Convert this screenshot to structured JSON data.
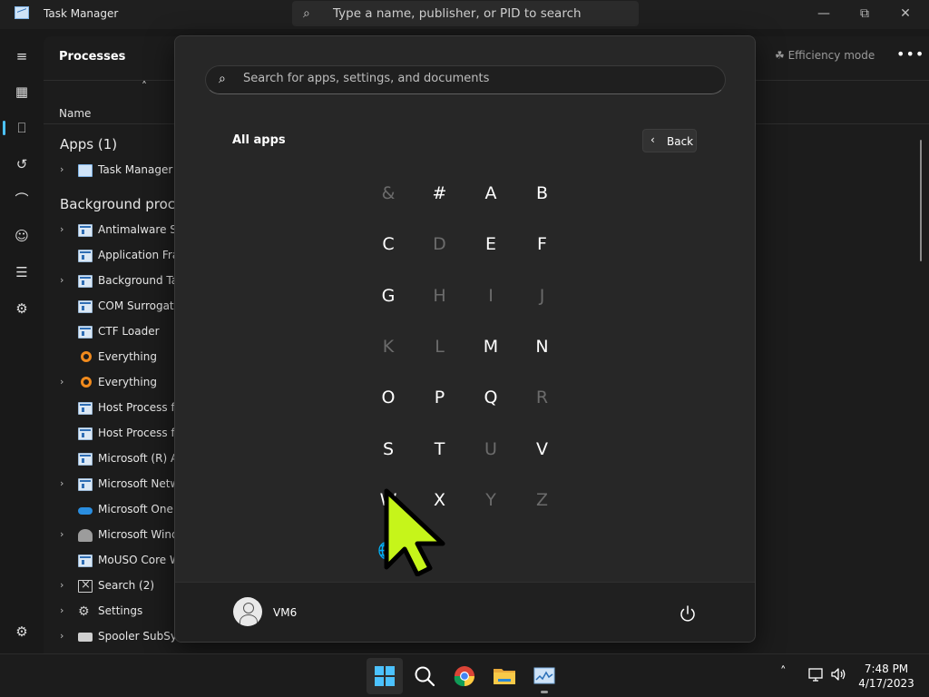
{
  "task_manager": {
    "title": "Task Manager",
    "search_placeholder": "Type a name, publisher, or PID to search",
    "page_heading": "Processes",
    "efficiency_mode_label": "Efficiency mode",
    "more_label": "•••",
    "column_name": "Name",
    "groups": {
      "apps": "Apps (1)",
      "background": "Background proce"
    },
    "processes": [
      {
        "label": "Task Manager",
        "icon": "task-manager-icon",
        "expandable": true
      },
      {
        "label": "Antimalware Ser",
        "icon": "window-icon",
        "expandable": true
      },
      {
        "label": "Application Fran",
        "icon": "window-icon",
        "expandable": false
      },
      {
        "label": "Background Tas",
        "icon": "window-icon",
        "expandable": true
      },
      {
        "label": "COM Surrogate",
        "icon": "window-icon",
        "expandable": false
      },
      {
        "label": "CTF Loader",
        "icon": "window-icon",
        "expandable": false
      },
      {
        "label": "Everything",
        "icon": "everything-icon",
        "expandable": false
      },
      {
        "label": "Everything",
        "icon": "everything-icon",
        "expandable": true
      },
      {
        "label": "Host Process for",
        "icon": "window-icon",
        "expandable": false
      },
      {
        "label": "Host Process for",
        "icon": "window-icon",
        "expandable": false
      },
      {
        "label": "Microsoft (R) Ag",
        "icon": "window-icon",
        "expandable": false
      },
      {
        "label": "Microsoft Netwo",
        "icon": "window-icon",
        "expandable": true
      },
      {
        "label": "Microsoft OneD",
        "icon": "onedrive-icon",
        "expandable": false
      },
      {
        "label": "Microsoft Windo",
        "icon": "user-icon",
        "expandable": true
      },
      {
        "label": "MoUSO Core W",
        "icon": "window-icon",
        "expandable": false
      },
      {
        "label": "Search (2)",
        "icon": "search-app-icon",
        "expandable": true
      },
      {
        "label": "Settings",
        "icon": "gear-icon",
        "expandable": true
      },
      {
        "label": "Spooler SubSyst",
        "icon": "printer-icon",
        "expandable": true
      }
    ],
    "nav_icons": [
      "hamburger-icon",
      "processes-icon",
      "performance-icon",
      "app-history-icon",
      "startup-apps-icon",
      "users-icon",
      "details-icon",
      "services-icon",
      "settings-icon"
    ]
  },
  "start_menu": {
    "search_placeholder": "Search for apps, settings, and documents",
    "all_apps_title": "All apps",
    "back_label": "Back",
    "letters": [
      {
        "char": "&",
        "enabled": false
      },
      {
        "char": "#",
        "enabled": true
      },
      {
        "char": "A",
        "enabled": true
      },
      {
        "char": "B",
        "enabled": true
      },
      {
        "char": "C",
        "enabled": true
      },
      {
        "char": "D",
        "enabled": false
      },
      {
        "char": "E",
        "enabled": true
      },
      {
        "char": "F",
        "enabled": true
      },
      {
        "char": "G",
        "enabled": true
      },
      {
        "char": "H",
        "enabled": false
      },
      {
        "char": "I",
        "enabled": false
      },
      {
        "char": "J",
        "enabled": false
      },
      {
        "char": "K",
        "enabled": false
      },
      {
        "char": "L",
        "enabled": false
      },
      {
        "char": "M",
        "enabled": true
      },
      {
        "char": "N",
        "enabled": true
      },
      {
        "char": "O",
        "enabled": true
      },
      {
        "char": "P",
        "enabled": true
      },
      {
        "char": "Q",
        "enabled": true
      },
      {
        "char": "R",
        "enabled": false
      },
      {
        "char": "S",
        "enabled": true
      },
      {
        "char": "T",
        "enabled": true
      },
      {
        "char": "U",
        "enabled": false
      },
      {
        "char": "V",
        "enabled": true
      },
      {
        "char": "W",
        "enabled": true
      },
      {
        "char": "X",
        "enabled": true
      },
      {
        "char": "Y",
        "enabled": false
      },
      {
        "char": "Z",
        "enabled": false
      },
      {
        "char": "🌐",
        "enabled": false
      }
    ],
    "user_name": "VM6"
  },
  "taskbar": {
    "apps": [
      "windows-start-icon",
      "search-icon",
      "chrome-icon",
      "file-explorer-icon",
      "task-manager-icon"
    ],
    "time": "7:48 PM",
    "date": "4/17/2023"
  },
  "colors": {
    "accent": "#4cc2ff",
    "cursor": "#c6f51a",
    "start_bg": "#272727",
    "disabled_letter": "#6b6b6b"
  }
}
